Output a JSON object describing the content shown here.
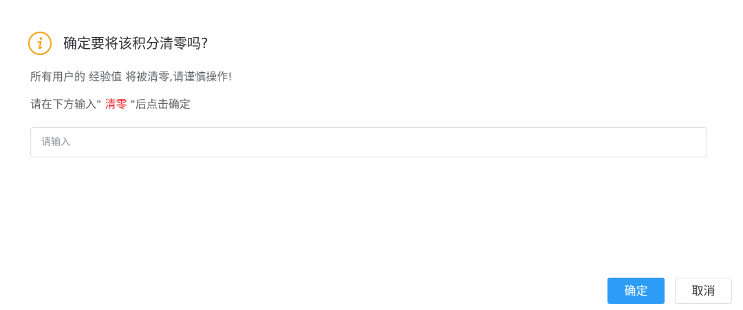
{
  "dialog": {
    "title": "确定要将该积分清零吗?",
    "message": "所有用户的 经验值 将被清零,请谨慎操作!",
    "instruction_prefix": "请在下方输入\" ",
    "instruction_keyword": "清零",
    "instruction_suffix": " \"后点击确定",
    "input_placeholder": "请输入",
    "input_value": "",
    "confirm_label": "确定",
    "cancel_label": "取消"
  },
  "icons": {
    "warning": "info-warning-icon"
  },
  "colors": {
    "warning": "#f5a623",
    "primary": "#2d9cf7",
    "danger": "#f5222d",
    "title_text": "#303133",
    "body_text": "#606266",
    "border": "#dcdfe6"
  }
}
